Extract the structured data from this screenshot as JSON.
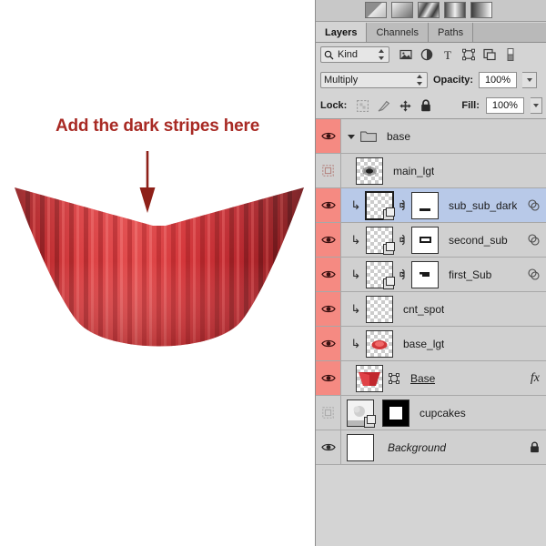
{
  "annotation": {
    "text": "Add the dark stripes here",
    "color": "#a82a24",
    "arrow_icon": "down-arrow-icon"
  },
  "artwork": {
    "name": "cupcake-wrapper-illustration",
    "base_color": "#c1272d",
    "highlight_color": "#e8484a",
    "shadow_color": "#7e1418"
  },
  "gradient_strip": {
    "presets": [
      "gradient-preset-1",
      "gradient-preset-2",
      "gradient-preset-3",
      "gradient-preset-4",
      "gradient-preset-5"
    ]
  },
  "panel": {
    "tabs": [
      {
        "label": "Layers",
        "active": true
      },
      {
        "label": "Channels",
        "active": false
      },
      {
        "label": "Paths",
        "active": false
      }
    ],
    "filter": {
      "search_icon": "magnifier-icon",
      "kind_label": "Kind",
      "icons": [
        "pixel-layer-filter-icon",
        "adjustment-layer-filter-icon",
        "type-layer-filter-icon",
        "shape-layer-filter-icon",
        "smart-object-filter-icon",
        "filter-toggle-switch-icon"
      ]
    },
    "blend": {
      "mode": "Multiply",
      "opacity_label": "Opacity:",
      "opacity_value": "100%"
    },
    "lock": {
      "label": "Lock:",
      "icons": [
        "lock-transparency-icon",
        "lock-image-pixels-icon",
        "lock-position-icon",
        "lock-all-icon"
      ],
      "fill_label": "Fill:",
      "fill_value": "100%"
    },
    "layers": [
      {
        "name": "base",
        "type": "group",
        "visible": true,
        "selected": false,
        "expanded": true,
        "clipped": false,
        "has_thumb": false,
        "has_mask": false,
        "fx": false,
        "locked": false,
        "clip_marker": false
      },
      {
        "name": "main_lgt",
        "type": "layer",
        "visible": false,
        "selected": false,
        "clipped": false,
        "has_thumb": true,
        "thumb_style": "transparent-eye-shape",
        "has_mask": false,
        "fx": false,
        "locked": false,
        "clip_marker": false
      },
      {
        "name": "sub_sub_dark",
        "type": "layer",
        "visible": true,
        "selected": true,
        "clipped": true,
        "has_thumb": true,
        "thumb_style": "transparent-smart-object",
        "has_mask": true,
        "mask_style": "white-with-small-bar",
        "fx": false,
        "locked": false,
        "clip_marker": true
      },
      {
        "name": "second_sub",
        "type": "layer",
        "visible": true,
        "selected": false,
        "clipped": true,
        "has_thumb": true,
        "thumb_style": "transparent-smart-object",
        "has_mask": true,
        "mask_style": "white-with-rect",
        "fx": false,
        "locked": false,
        "clip_marker": true
      },
      {
        "name": "first_Sub",
        "type": "layer",
        "visible": true,
        "selected": false,
        "clipped": true,
        "has_thumb": true,
        "thumb_style": "transparent-smart-object",
        "has_mask": true,
        "mask_style": "white-with-step",
        "fx": false,
        "locked": false,
        "clip_marker": true
      },
      {
        "name": "cnt_spot",
        "type": "layer",
        "visible": true,
        "selected": false,
        "clipped": true,
        "has_thumb": true,
        "thumb_style": "transparent-empty",
        "has_mask": false,
        "fx": false,
        "locked": false,
        "clip_marker": false
      },
      {
        "name": "base_lgt",
        "type": "layer",
        "visible": true,
        "selected": false,
        "clipped": true,
        "has_thumb": true,
        "thumb_style": "transparent-red-blob",
        "has_mask": false,
        "fx": false,
        "locked": false,
        "clip_marker": false
      },
      {
        "name": "Base",
        "type": "layer",
        "visible": true,
        "selected": false,
        "clipped": false,
        "has_thumb": true,
        "thumb_style": "red-cupcake",
        "has_mask": false,
        "fx": true,
        "locked": false,
        "clip_marker": false,
        "underlined": true
      },
      {
        "name": "cupcakes",
        "type": "layer",
        "visible": false,
        "selected": false,
        "clipped": false,
        "has_thumb": true,
        "thumb_style": "grey-photo-smart-object",
        "has_mask": true,
        "mask_style": "black-with-white-square",
        "fx": false,
        "locked": false,
        "clip_marker": false
      },
      {
        "name": "Background",
        "type": "layer",
        "visible": true,
        "selected": false,
        "clipped": false,
        "has_thumb": true,
        "thumb_style": "solid-white",
        "has_mask": false,
        "fx": false,
        "locked": true,
        "clip_marker": false,
        "italic": true
      }
    ]
  },
  "colors": {
    "panel_bg": "#d4d4d4",
    "row_bg": "#d0d0d0",
    "selected_row": "#b8c9e8",
    "visible_eye_cell": "#f58a82",
    "annotation_red": "#a82a24"
  }
}
